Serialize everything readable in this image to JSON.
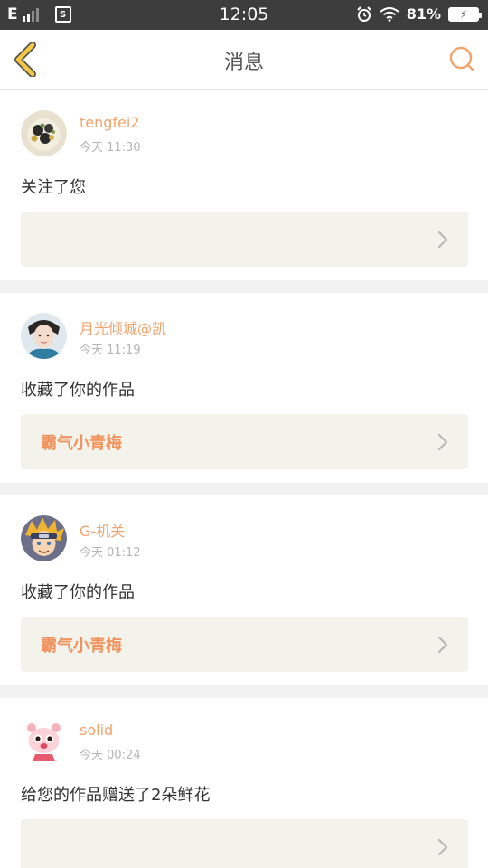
{
  "status_bar": {
    "carrier": "E",
    "screenshot_label": "S",
    "time": "12:05",
    "battery_percent": "81%",
    "battery_charging_symbol": "⚡"
  },
  "header": {
    "title": "消息"
  },
  "notifications": [
    {
      "username": "tengfei2",
      "time": "今天 11:30",
      "message": "关注了您",
      "work_title": ""
    },
    {
      "username": "月光倾城@凯",
      "time": "今天 11:19",
      "message": "收藏了你的作品",
      "work_title": "霸气小青梅"
    },
    {
      "username": "G-机关",
      "time": "今天 01:12",
      "message": "收藏了你的作品",
      "work_title": "霸气小青梅"
    },
    {
      "username": "solid",
      "time": "今天 00:24",
      "message": "给您的作品赠送了2朵鲜花",
      "work_title": ""
    }
  ],
  "colors": {
    "accent": "#f0a36b",
    "back_icon_fill": "#f5c842",
    "status_bar_bg": "#3d3d3d"
  }
}
